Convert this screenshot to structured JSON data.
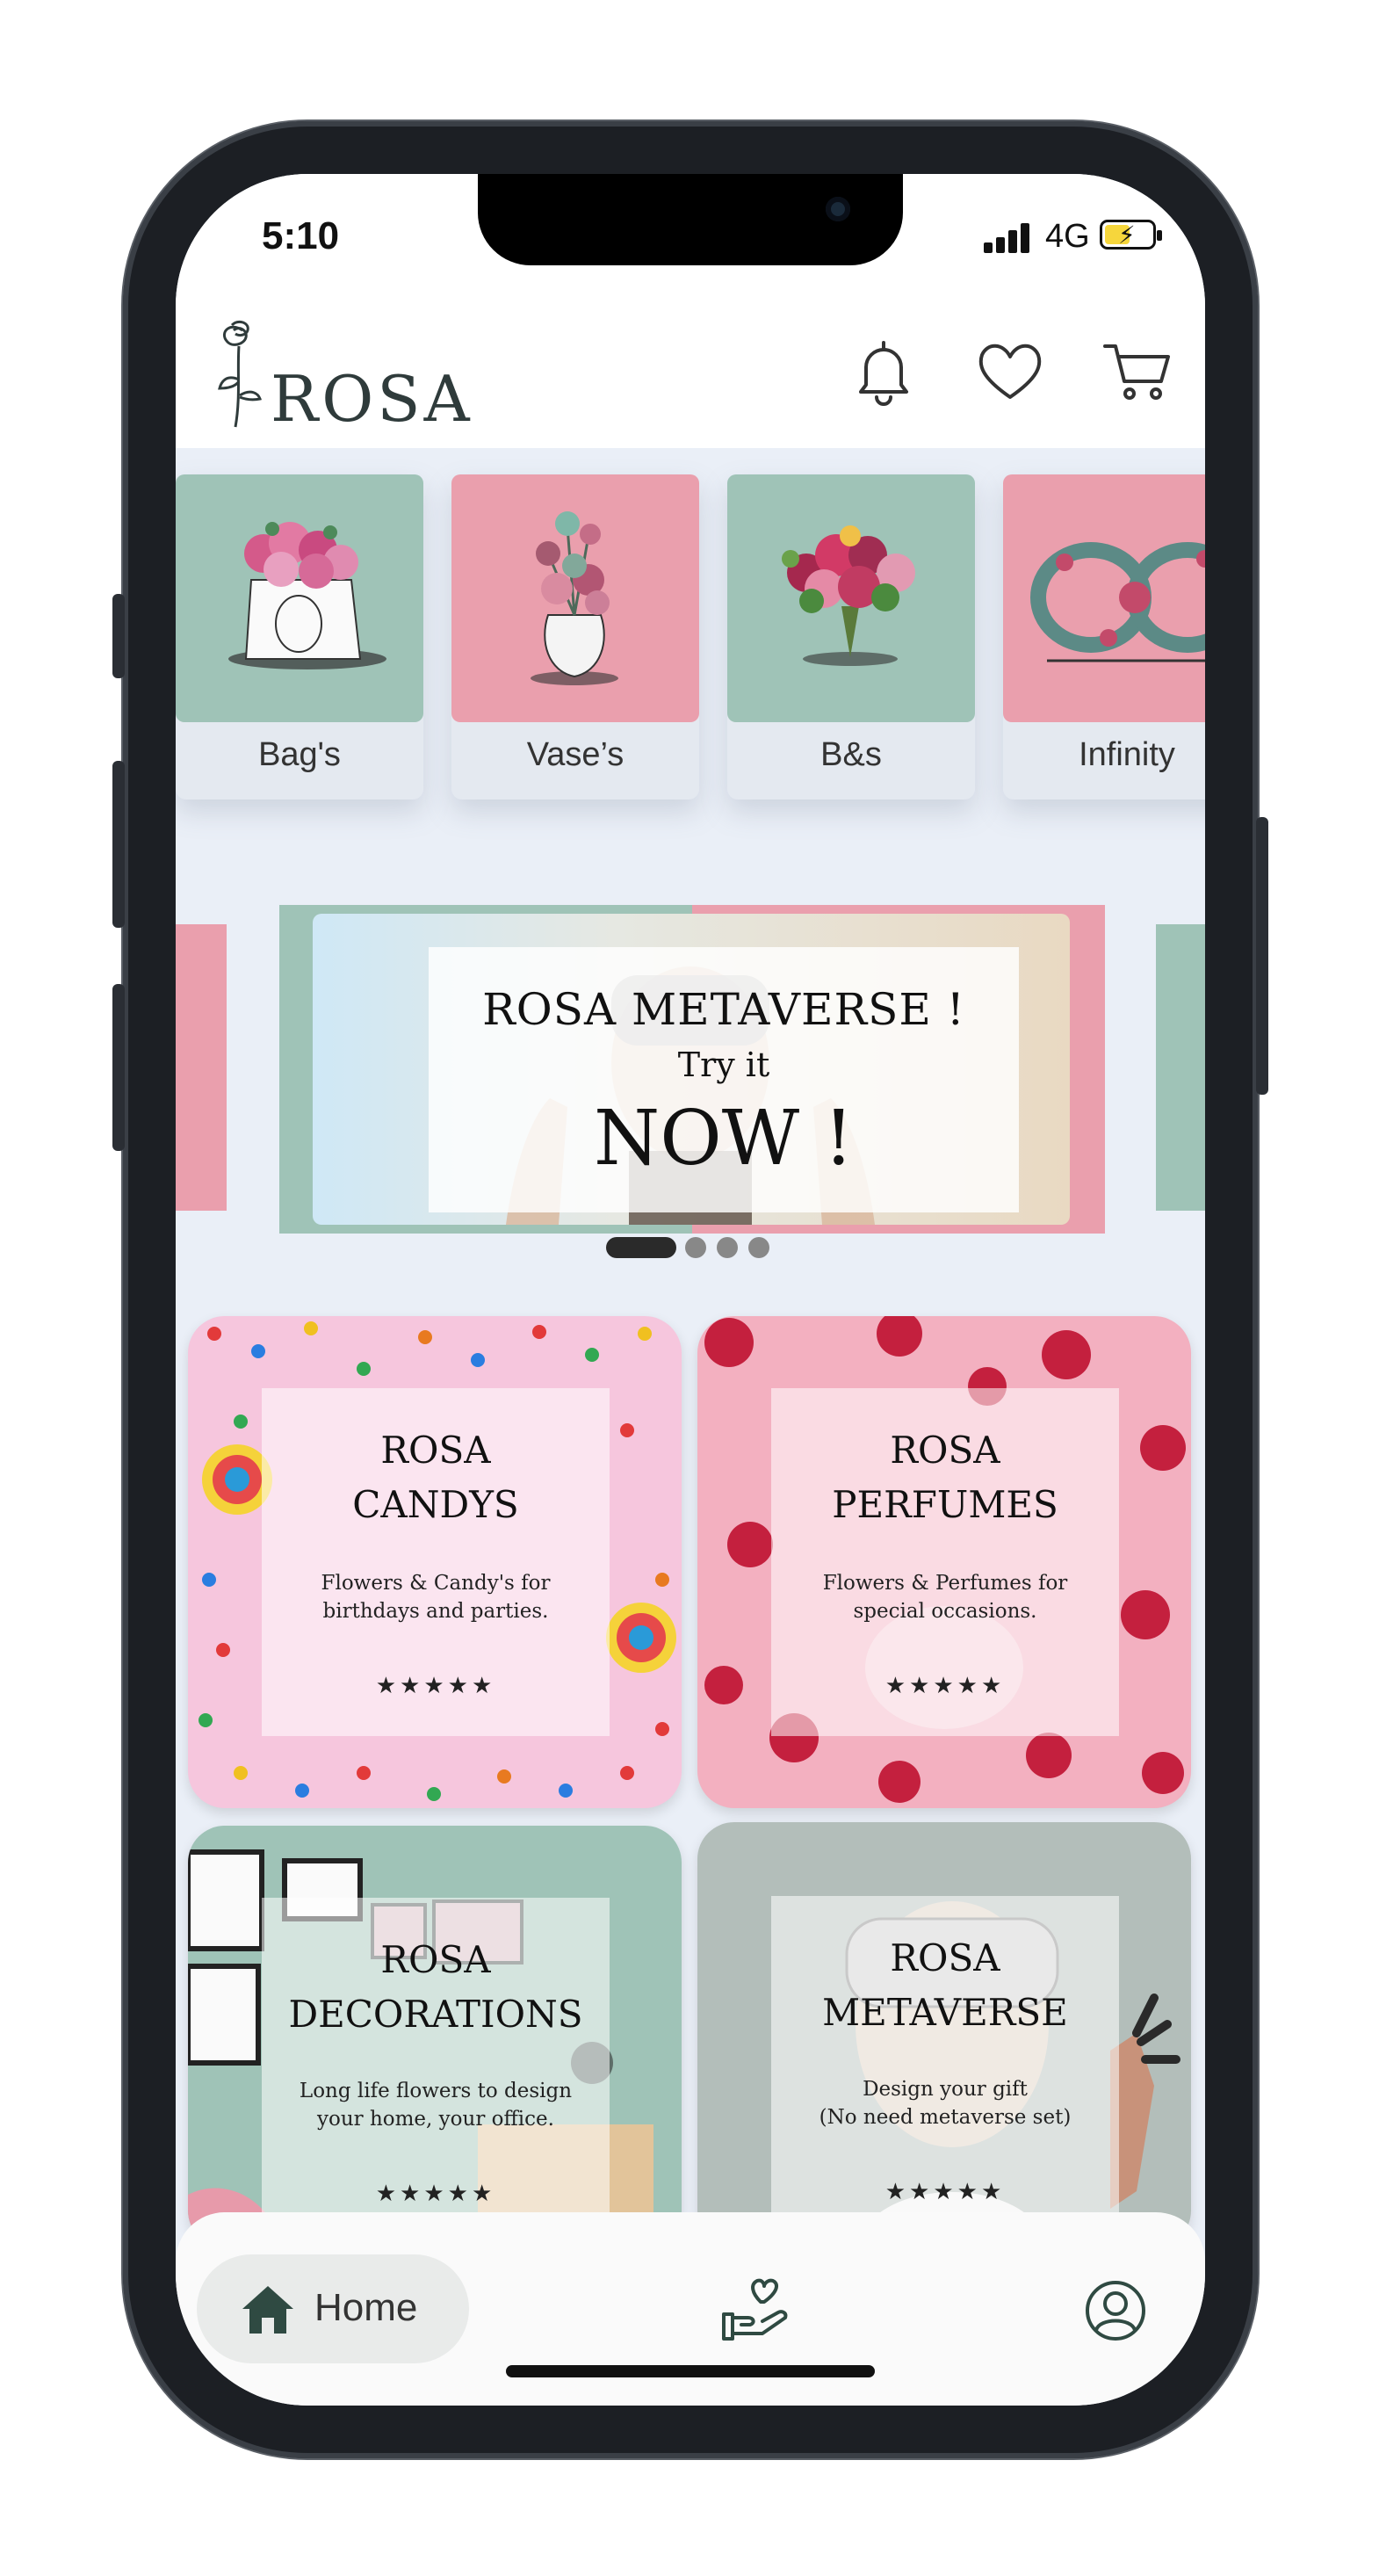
{
  "status_bar": {
    "time": "5:10",
    "network": "4G"
  },
  "header": {
    "logo_text": "ROSA"
  },
  "categories": [
    {
      "label": "Bag's",
      "color": "#9fc3b7"
    },
    {
      "label": "Vase’s",
      "color": "#ea9fad"
    },
    {
      "label": "B&s",
      "color": "#9fc3b7"
    },
    {
      "label": "Infinity",
      "color": "#ea9fad"
    }
  ],
  "banner": {
    "title": "ROSA METAVERSE !",
    "subtitle": "Try it",
    "cta": "NOW !",
    "dots_total": 4,
    "active_dot": 0
  },
  "products": [
    {
      "title_line1": "ROSA",
      "title_line2": "CANDYS",
      "desc_line1": "Flowers & Candy's for",
      "desc_line2": "birthdays and parties.",
      "stars": "★★★★★"
    },
    {
      "title_line1": "ROSA",
      "title_line2": "PERFUMES",
      "desc_line1": "Flowers & Perfumes for",
      "desc_line2": "special occasions.",
      "stars": "★★★★★"
    },
    {
      "title_line1": "ROSA",
      "title_line2": "DECORATIONS",
      "desc_line1": "Long life flowers to design",
      "desc_line2": "your home, your office.",
      "stars": "★★★★★"
    },
    {
      "title_line1": "ROSA",
      "title_line2": "METAVERSE",
      "desc_line1": "Design your gift",
      "desc_line2": "(No need metaverse set)",
      "stars": "★★★★★"
    }
  ],
  "bottom_nav": {
    "home_label": "Home"
  },
  "colors": {
    "mint": "#9fc3b7",
    "rose": "#ea9fad",
    "background": "#eaeff7",
    "candy_bg": "#f6c6dd",
    "perfume_bg": "#f3b0c0"
  }
}
